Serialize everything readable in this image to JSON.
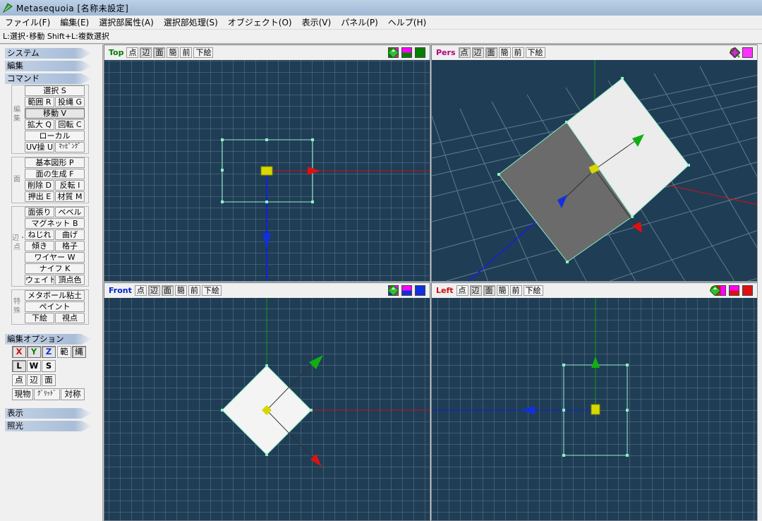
{
  "window": {
    "title": "Metasequoia [名称未設定]"
  },
  "menu": [
    "ファイル(F)",
    "編集(E)",
    "選択部属性(A)",
    "選択部処理(S)",
    "オブジェクト(O)",
    "表示(V)",
    "パネル(P)",
    "ヘルプ(H)"
  ],
  "status": "L:選択･移動  Shift+L:複数選択",
  "panel": {
    "sections": {
      "system": "システム",
      "edit": "編集",
      "command": "コマンド",
      "edit_option": "編集オプション",
      "display": "表示",
      "lighting": "照光"
    },
    "groups": {
      "edit": "編集",
      "face": "面",
      "edge_vertex": "辺・点",
      "special": "特殊"
    },
    "commands": {
      "select": "選択 S",
      "range": "範囲 R",
      "lasso": "投縄 G",
      "move": "移動 V",
      "scale": "拡大 Q",
      "rotate": "回転 C",
      "local": "ローカル",
      "uv": "UV操 U",
      "mapping": "ﾏｯﾋﾟﾝｸﾞ",
      "primitive": "基本図形 P",
      "create_face": "面の生成 F",
      "delete": "削除 D",
      "flip": "反転 I",
      "extrude": "押出 E",
      "material": "材質 M",
      "face_cut": "面張り",
      "bevel": "ベベル",
      "magnet": "マグネット B",
      "twist": "ねじれ",
      "bend": "曲げ",
      "tilt": "傾き",
      "lattice": "格子",
      "wire": "ワイヤー W",
      "knife": "ナイフ K",
      "weight": "ウェイト",
      "vertex_color": "頂点色",
      "metaball": "メタボール粘土",
      "paint": "ペイント",
      "underlay": "下絵",
      "viewpoint": "視点"
    },
    "options": {
      "x": "X",
      "y": "Y",
      "z": "Z",
      "range": "範",
      "lasso": "縄",
      "l": "L",
      "w": "W",
      "s": "S",
      "point": "点",
      "edge": "辺",
      "face": "面",
      "current": "現物",
      "grid": "ｸﾞﾘｯﾄﾞ",
      "symmetry": "対称"
    }
  },
  "viewports": {
    "top": {
      "name": "Top",
      "buttons": [
        "点",
        "辺",
        "面",
        "簡",
        "前",
        "下絵"
      ]
    },
    "pers": {
      "name": "Pers",
      "buttons": [
        "点",
        "辺",
        "面",
        "簡",
        "前",
        "下絵"
      ]
    },
    "front": {
      "name": "Front",
      "buttons": [
        "点",
        "辺",
        "面",
        "簡",
        "前",
        "下絵"
      ]
    },
    "left": {
      "name": "Left",
      "buttons": [
        "点",
        "辺",
        "面",
        "簡",
        "前",
        "下絵"
      ]
    }
  },
  "colors": {
    "viewport_bg": "#203d56",
    "grid": "#5f7a8c",
    "axis_x": "#d01010",
    "axis_y": "#10a010",
    "axis_z": "#1020e0",
    "selection": "#8ff0c8",
    "handle_center": "#e0e000"
  }
}
